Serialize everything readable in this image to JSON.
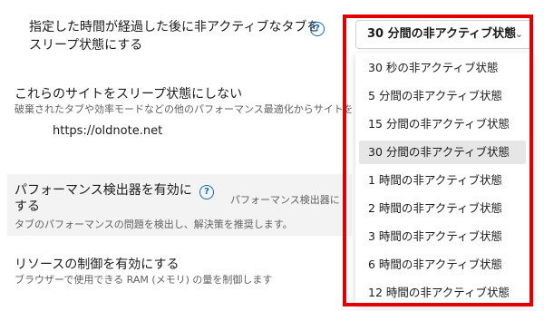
{
  "settings": {
    "sleep_after": {
      "title_line1": "指定した時間が経過した後に非アクティブなタブを",
      "title_line2": "スリープ状態にする",
      "help": "?"
    },
    "never_sleep": {
      "title": "これらのサイトをスリープ状態にしない",
      "desc": "破棄されたタブや効率モードなどの他のパフォーマンス最適化からサイトを",
      "site": "https://oldnote.net"
    },
    "perf_detector": {
      "title_line1": "パフォーマンス検出器を有効に",
      "title_line2": "する",
      "help": "?",
      "extra": "パフォーマンス検出器に",
      "desc": "タブのパフォーマンスの問題を検出し、解決策を推奨します。"
    },
    "resource_limit": {
      "title": "リソースの制御を有効にする",
      "desc": "ブラウザーで使用できる RAM (メモリ) の量を制御します"
    }
  },
  "select": {
    "value": "30 分間の非アクティブ状態",
    "chevron": "⌄",
    "options": [
      "30 秒の非アクティブ状態",
      "5 分間の非アクティブ状態",
      "15 分間の非アクティブ状態",
      "30 分間の非アクティブ状態",
      "1 時間の非アクティブ状態",
      "2 時間の非アクティブ状態",
      "3 時間の非アクティブ状態",
      "6 時間の非アクティブ状態",
      "12 時間の非アクティブ状態"
    ],
    "selected_index": 3
  },
  "colors": {
    "highlight_frame": "#e00000",
    "accent": "#0f6cbd"
  }
}
